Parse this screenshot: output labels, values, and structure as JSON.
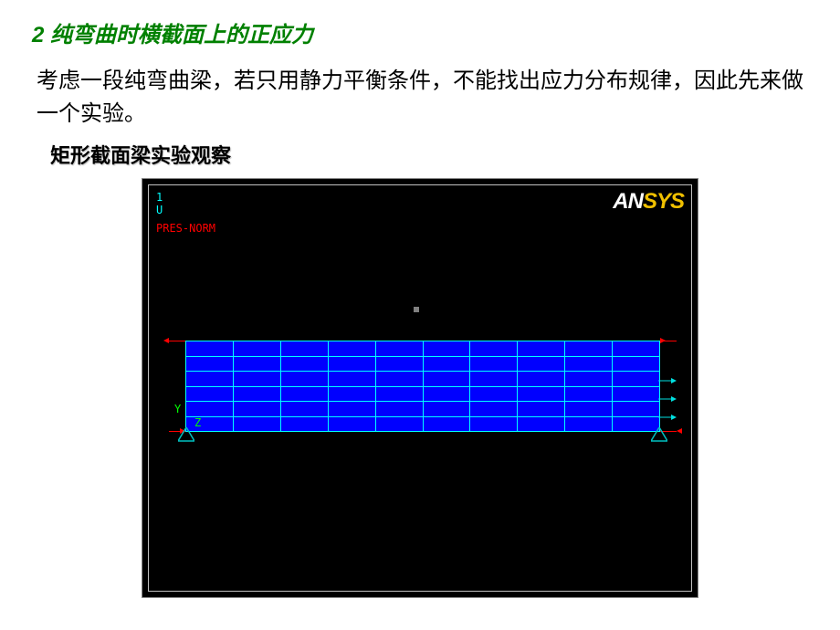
{
  "section": {
    "number": "2",
    "title": "2 纯弯曲时横截面上的正应力"
  },
  "body": "考虑一段纯弯曲梁，若只用静力平衡条件，不能找出应力分布规律，因此先来做一个实验。",
  "subsection": "矩形截面梁实验观察",
  "ansys": {
    "legend_1": "1",
    "legend_u": "U",
    "legend_pres": "PRES-NORM",
    "logo_an": "AN",
    "logo_sys": "SYS",
    "axis_y": "Y",
    "axis_z": "Z"
  },
  "beam": {
    "cols": 10,
    "rows": 6,
    "cell_color": "#0000ff",
    "grid_color": "#00ffff"
  }
}
